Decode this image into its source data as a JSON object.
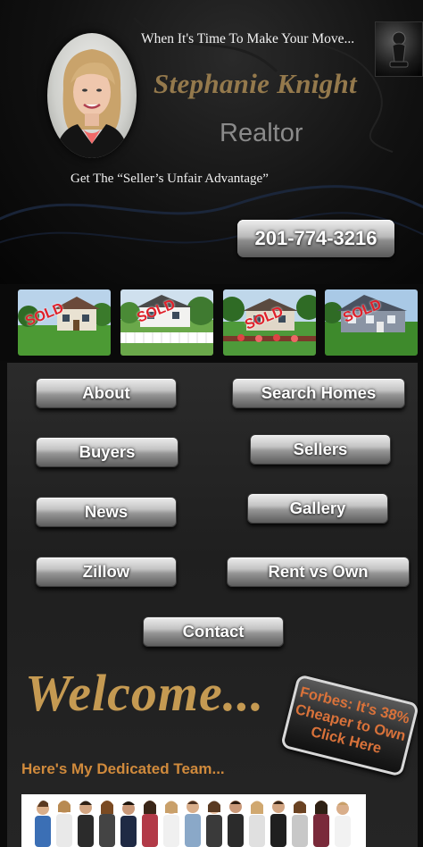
{
  "header": {
    "tagline": "When It's Time To Make Your Move...",
    "name": "Stephanie Knight",
    "title": "Realtor",
    "advantage": "Get The “Seller’s Unfair Advantage”",
    "phone": "201-774-3216"
  },
  "listings": [
    {
      "label": "SOLD"
    },
    {
      "label": "SOLD"
    },
    {
      "label": "SOLD"
    },
    {
      "label": "SOLD"
    }
  ],
  "nav": {
    "about": "About",
    "search_homes": "Search Homes",
    "buyers": "Buyers",
    "sellers": "Sellers",
    "news": "News",
    "gallery": "Gallery",
    "zillow": "Zillow",
    "rent_vs_own": "Rent vs Own",
    "contact": "Contact"
  },
  "welcome": {
    "heading": "Welcome...",
    "forbes_line1": "Forbes: It's 38%",
    "forbes_line2": "Cheaper to Own",
    "forbes_line3": "Click Here",
    "team_heading": "Here's My Dedicated Team..."
  },
  "colors": {
    "name_gold": "#94794c",
    "welcome_gold": "#c59a52",
    "team_orange": "#d08a3c",
    "sold_red": "#e0202a"
  }
}
